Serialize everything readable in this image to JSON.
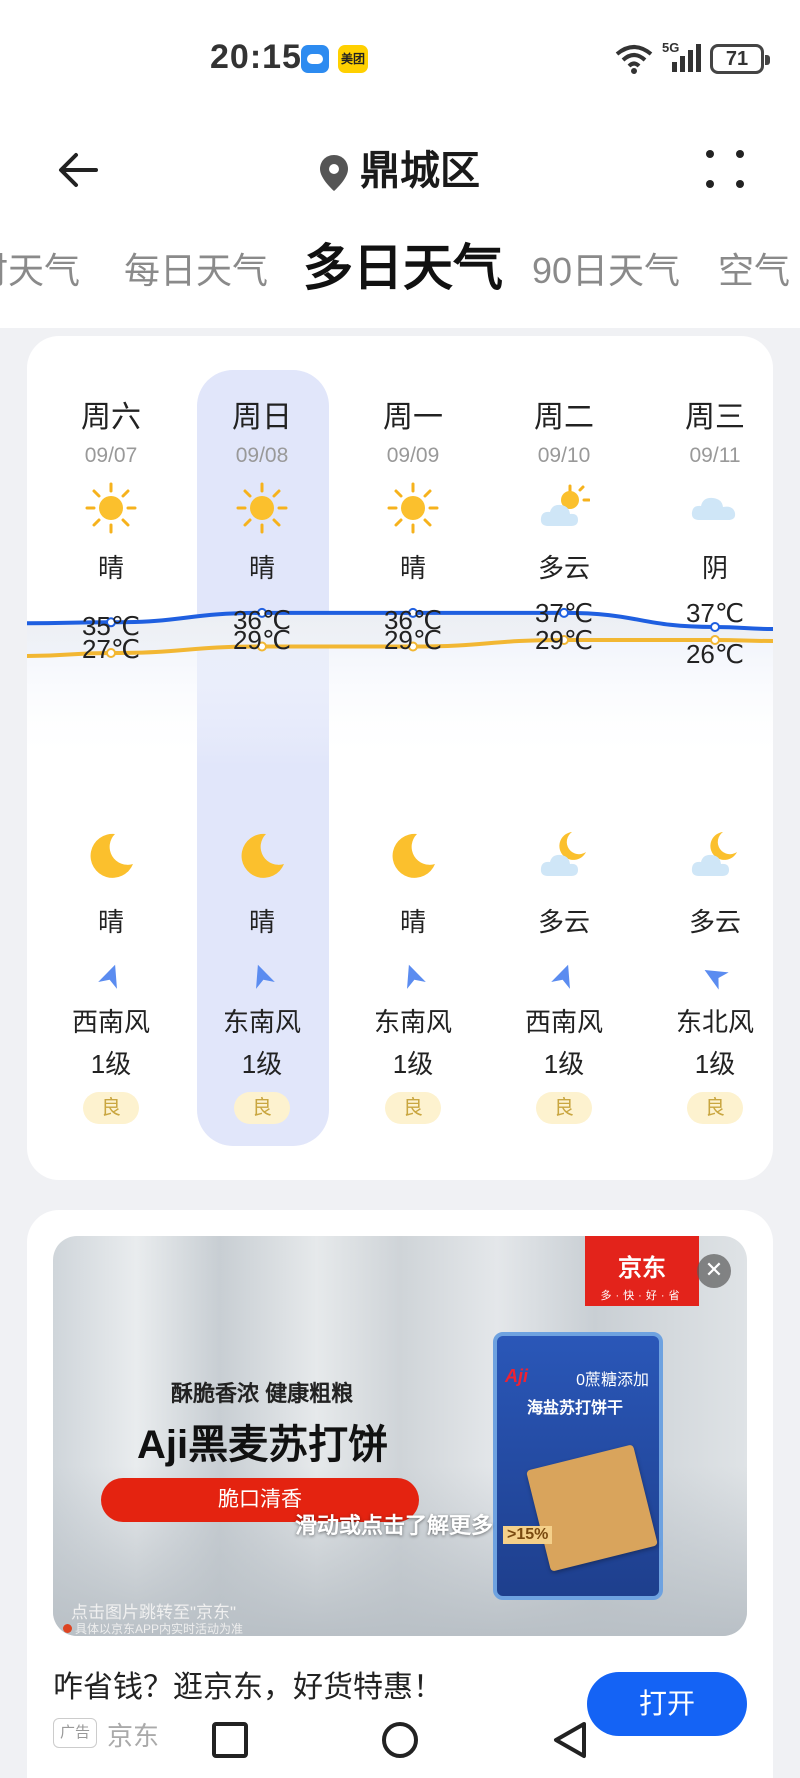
{
  "status_bar": {
    "time": "20:15",
    "battery": "71",
    "network": "5G",
    "meituan_label": "美团"
  },
  "header": {
    "location": "鼎城区"
  },
  "tabs": [
    {
      "label": "时天气",
      "active": false
    },
    {
      "label": "每日天气",
      "active": false
    },
    {
      "label": "多日天气",
      "active": true
    },
    {
      "label": "90日天气",
      "active": false
    },
    {
      "label": "空气",
      "active": false
    }
  ],
  "forecast": {
    "selected_index": 1,
    "days": [
      {
        "weekday": "周六",
        "date": "09/07",
        "day_icon": "sun-icon",
        "day_cond": "晴",
        "high": "35℃",
        "low": "27℃",
        "night_icon": "moon-icon",
        "night_cond": "晴",
        "wind_dir": "西南风",
        "wind_level": "1级",
        "aqi": "良"
      },
      {
        "weekday": "周日",
        "date": "09/08",
        "day_icon": "sun-icon",
        "day_cond": "晴",
        "high": "36℃",
        "low": "29℃",
        "night_icon": "moon-icon",
        "night_cond": "晴",
        "wind_dir": "东南风",
        "wind_level": "1级",
        "aqi": "良"
      },
      {
        "weekday": "周一",
        "date": "09/09",
        "day_icon": "sun-icon",
        "day_cond": "晴",
        "high": "36℃",
        "low": "29℃",
        "night_icon": "moon-icon",
        "night_cond": "晴",
        "wind_dir": "东南风",
        "wind_level": "1级",
        "aqi": "良"
      },
      {
        "weekday": "周二",
        "date": "09/10",
        "day_icon": "partly-cloudy-icon",
        "day_cond": "多云",
        "high": "37℃",
        "low": "29℃",
        "night_icon": "cloudy-night-icon",
        "night_cond": "多云",
        "wind_dir": "西南风",
        "wind_level": "1级",
        "aqi": "良"
      },
      {
        "weekday": "周三",
        "date": "09/11",
        "day_icon": "overcast-icon",
        "day_cond": "阴",
        "high": "37℃",
        "low": "26℃",
        "night_icon": "cloudy-night-icon",
        "night_cond": "多云",
        "wind_dir": "东北风",
        "wind_level": "1级",
        "aqi": "良"
      }
    ],
    "high_values": [
      35,
      36,
      36,
      37,
      37
    ],
    "low_values": [
      27,
      29,
      29,
      29,
      26
    ],
    "high_color": "#f2b733",
    "low_color": "#1f5fe0"
  },
  "ad": {
    "jd_title": "京东",
    "jd_slogan": "多·快·好·省",
    "subtitle": "酥脆香浓 健康粗粮",
    "title": "Aji黑麦苏打饼",
    "pill": "脆口清香",
    "swipe_hint": "滑动或点击了解更多",
    "jump_text": "点击图片跳转至\"京东\"",
    "note": "具体以京东APP内实时活动为准",
    "pack_brand": "Aji",
    "pack_zero": "0蔗糖添加",
    "pack_name": "海盐苏打饼干",
    "pack_pct": ">15%",
    "caption": "咋省钱？逛京东，好货特惠！",
    "tag": "广告",
    "source": "京东",
    "open_label": "打开"
  }
}
